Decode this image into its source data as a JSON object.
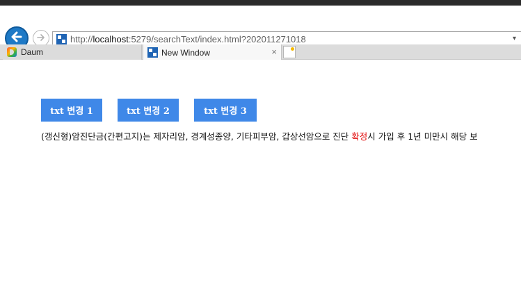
{
  "browser": {
    "url_prefix": "http://",
    "url_host": "localhost",
    "url_rest": ":5279/searchText/index.html?202011271018",
    "tabs": [
      {
        "label": "Daum"
      },
      {
        "label": "New Window"
      }
    ],
    "tab_close_glyph": "×"
  },
  "page": {
    "buttons": [
      {
        "label": "txt 변경 1"
      },
      {
        "label": "txt 변경 2"
      },
      {
        "label": "txt 변경 3"
      }
    ],
    "text_before": "(갱신형)암진단금(간편고지)는 제자리암, 경계성종양, 기타피부암, 갑상선암으로 진단 ",
    "text_highlight": "확정",
    "text_after": "시 가입 후 1년 미만시 해당 보",
    "highlight_color": "#e00000"
  }
}
